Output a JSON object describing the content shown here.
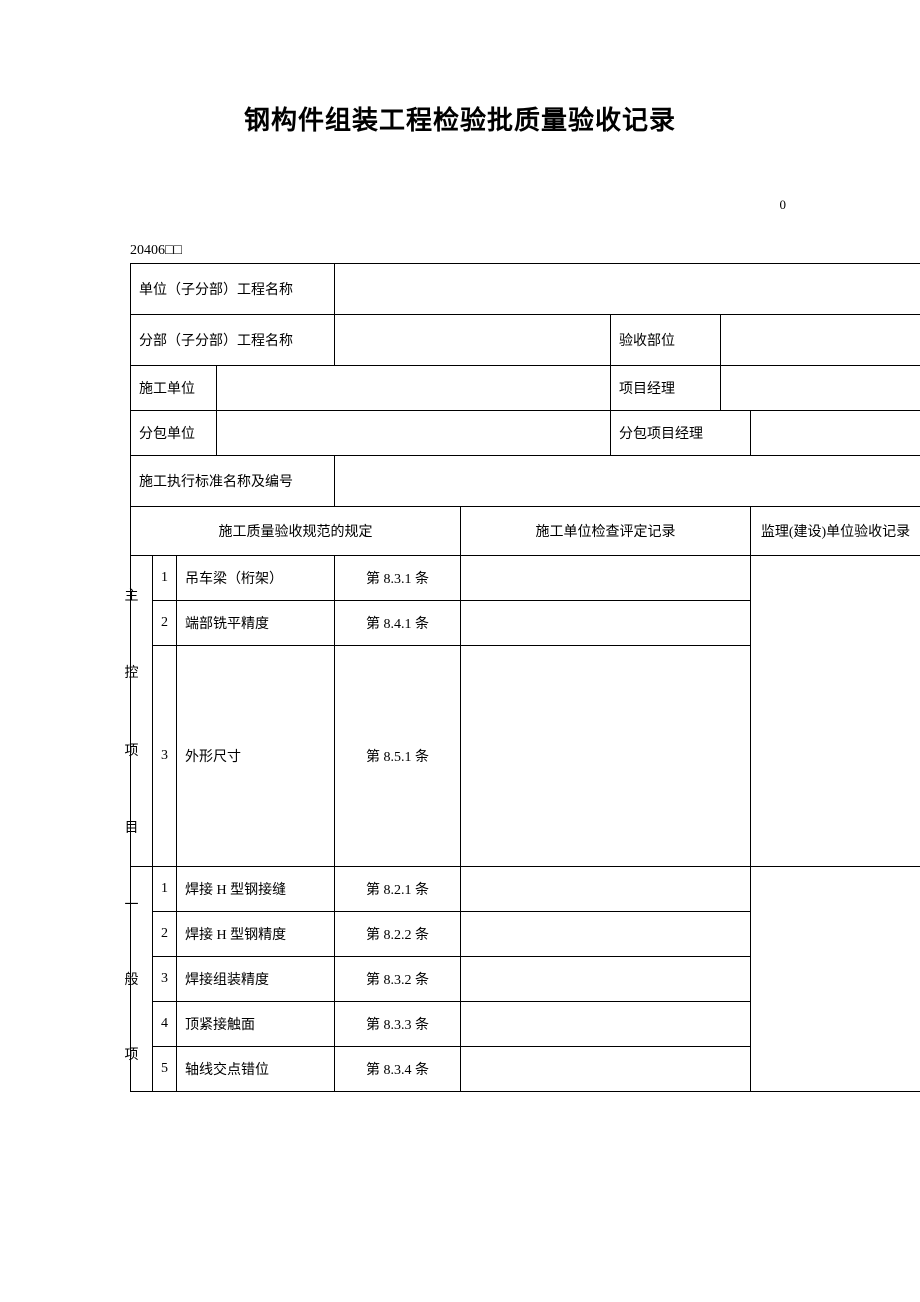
{
  "title": "钢构件组装工程检验批质量验收记录",
  "top_right": "0",
  "form_code": "20406□□",
  "header": {
    "unit_project_label": "单位（子分部）工程名称",
    "division_project_label": "分部（子分部）工程名称",
    "acceptance_part_label": "验收部位",
    "construction_unit_label": "施工单位",
    "project_manager_label": "项目经理",
    "subcontract_unit_label": "分包单位",
    "subcontract_pm_label": "分包项目经理",
    "standard_label": "施工执行标准名称及编号"
  },
  "columns": {
    "spec": "施工质量验收规范的规定",
    "check": "施工单位检查评定记录",
    "supervision": "监理(建设)单位验收记录"
  },
  "main_group_label_chars": [
    "主",
    "",
    "控",
    "",
    "",
    "项",
    "",
    "",
    "目"
  ],
  "general_group_label_chars": [
    "",
    "一",
    "",
    "",
    "般",
    "",
    "",
    "项"
  ],
  "main_items": [
    {
      "num": "1",
      "name": "吊车梁（桁架）",
      "clause": "第 8.3.1 条"
    },
    {
      "num": "2",
      "name": "端部铣平精度",
      "clause": "第 8.4.1 条"
    },
    {
      "num": "3",
      "name": "外形尺寸",
      "clause": "第 8.5.1 条"
    }
  ],
  "general_items": [
    {
      "num": "1",
      "name": "焊接 H 型钢接缝",
      "clause": "第 8.2.1 条"
    },
    {
      "num": "2",
      "name": "焊接 H 型钢精度",
      "clause": "第 8.2.2 条"
    },
    {
      "num": "3",
      "name": "焊接组装精度",
      "clause": "第 8.3.2 条"
    },
    {
      "num": "4",
      "name": "顶紧接触面",
      "clause": "第 8.3.3 条"
    },
    {
      "num": "5",
      "name": "轴线交点错位",
      "clause": "第 8.3.4 条"
    }
  ]
}
